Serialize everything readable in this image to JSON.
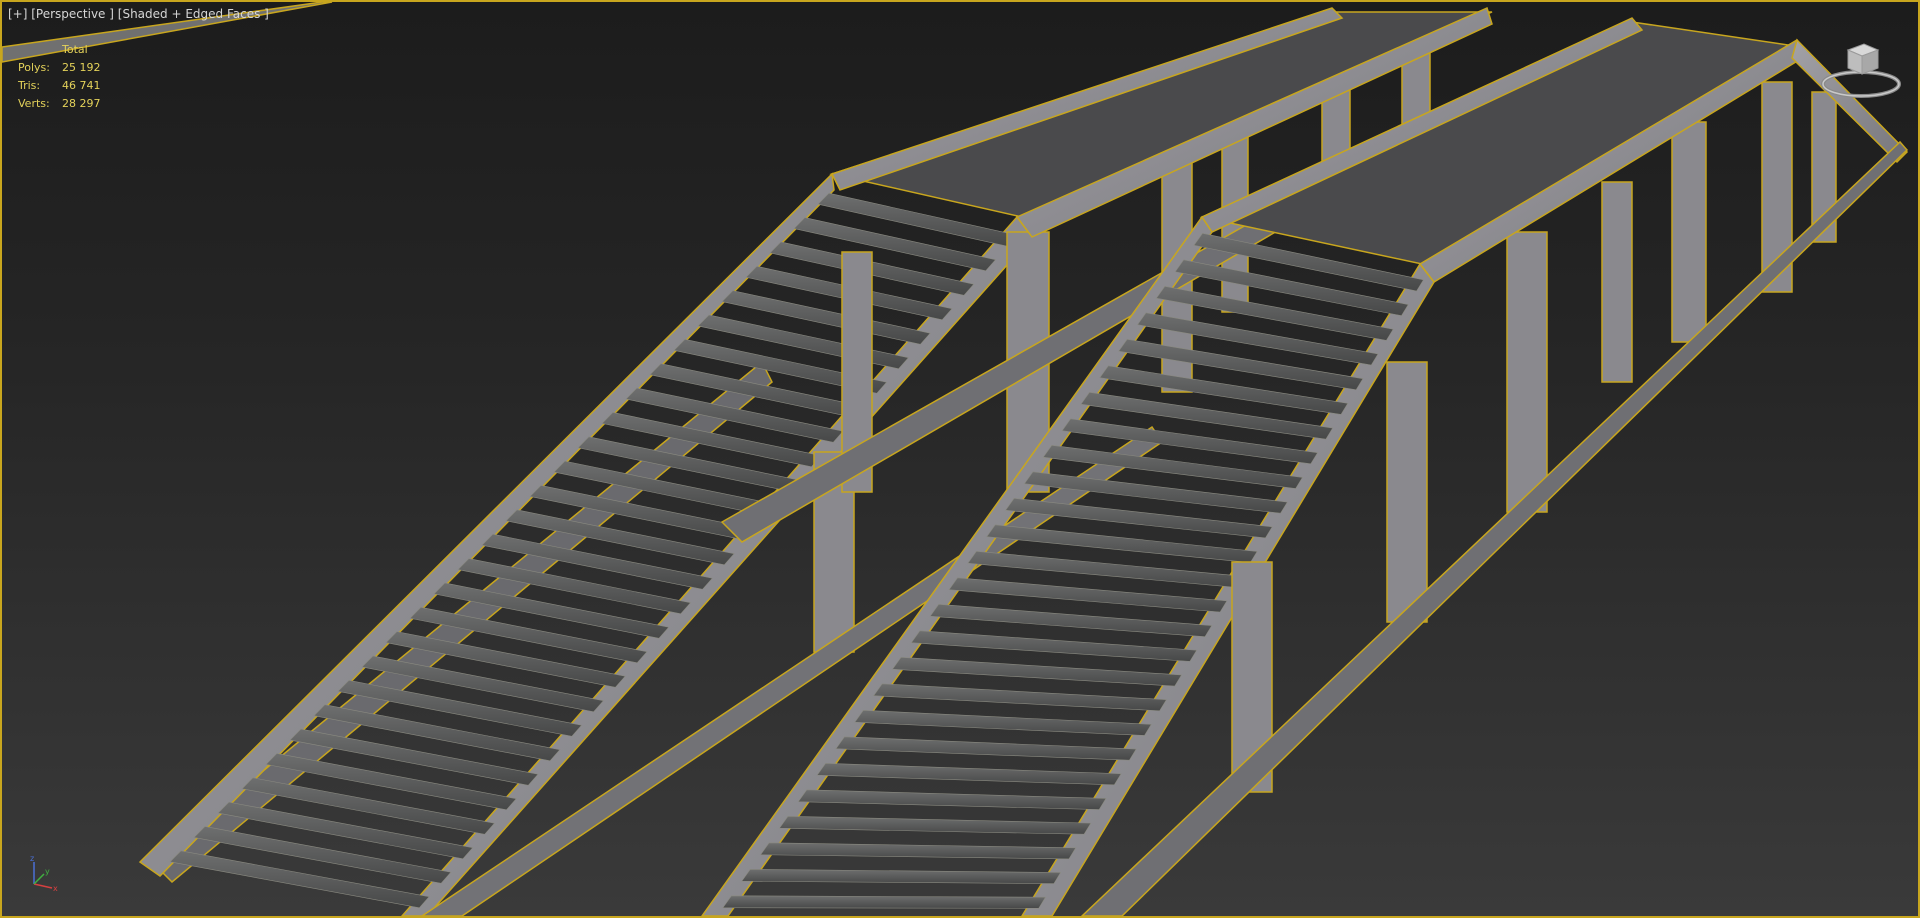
{
  "viewport": {
    "menu_plus": "[+]",
    "view_mode": "[Perspective ]",
    "shading_mode": "[Shaded + Edged Faces ]"
  },
  "stats": {
    "header": "Total",
    "rows": [
      {
        "label": "Polys:",
        "value": "25 192"
      },
      {
        "label": "Tris:",
        "value": "46 741"
      },
      {
        "label": "Verts:",
        "value": "28 297"
      }
    ]
  },
  "axis": {
    "z": "z",
    "x": "x",
    "y": "y"
  },
  "colors": {
    "selection_edge": "#c8a61e",
    "stats_text": "#e4d25a",
    "beam_face": "#8e8d92",
    "plank": "#5f6060",
    "background_top": "#1c1c1c",
    "background_bottom": "#3a3a3a"
  },
  "icons": {
    "viewcube": "viewcube-icon",
    "axis": "axis-tripod-icon"
  }
}
